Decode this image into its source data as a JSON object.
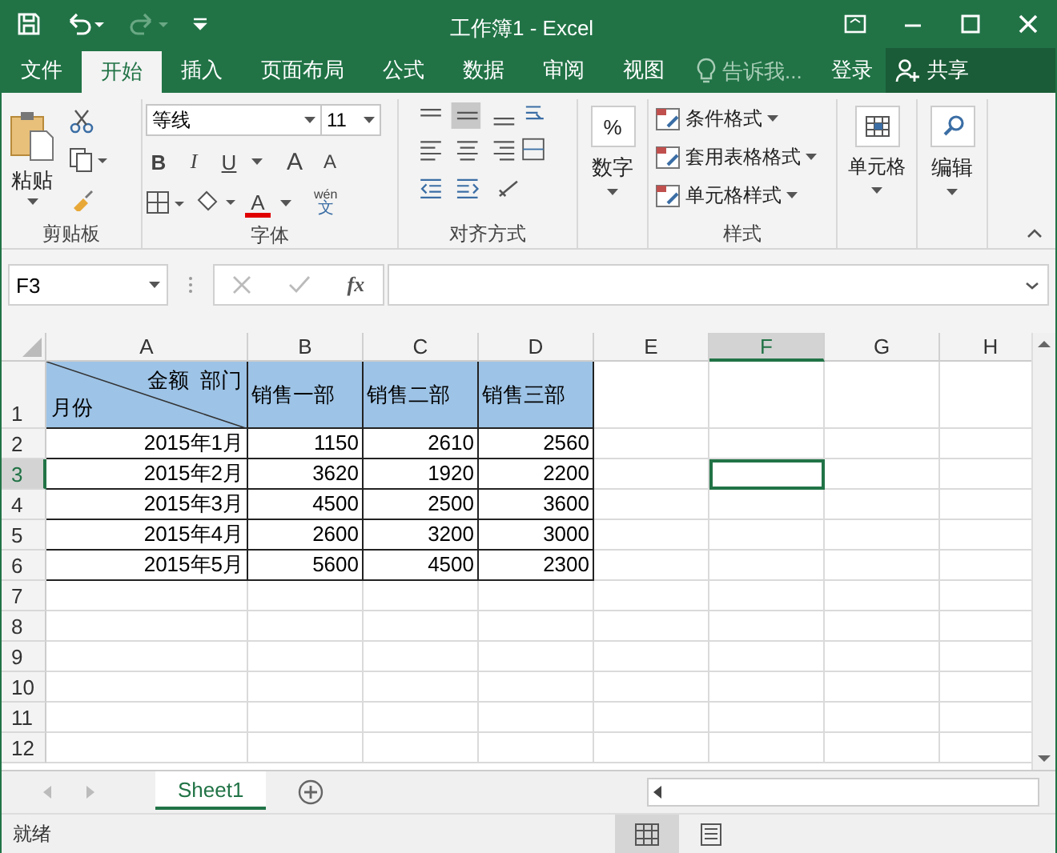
{
  "window": {
    "title": "工作簿1 - Excel"
  },
  "ribbon_tabs": [
    {
      "label": "文件",
      "selected": false
    },
    {
      "label": "开始",
      "selected": true
    },
    {
      "label": "插入",
      "selected": false
    },
    {
      "label": "页面布局",
      "selected": false
    },
    {
      "label": "公式",
      "selected": false
    },
    {
      "label": "数据",
      "selected": false
    },
    {
      "label": "审阅",
      "selected": false
    },
    {
      "label": "视图",
      "selected": false
    }
  ],
  "tell_me": {
    "placeholder": "告诉我..."
  },
  "sign_in": "登录",
  "share": "共享",
  "ribbon": {
    "clipboard": {
      "paste": "粘贴",
      "label": "剪贴板"
    },
    "font": {
      "name": "等线",
      "size": "11",
      "bold": "B",
      "italic": "I",
      "underline": "U",
      "grow": "A",
      "shrink": "A",
      "font_color": "A",
      "phonetic_top": "wén",
      "phonetic_bottom": "文",
      "label": "字体"
    },
    "alignment": {
      "label": "对齐方式"
    },
    "number": {
      "symbol": "%",
      "button": "数字"
    },
    "styles": {
      "items": [
        "条件格式",
        "套用表格格式",
        "单元格样式"
      ],
      "label": "样式"
    },
    "cells": {
      "button": "单元格"
    },
    "editing": {
      "button": "编辑"
    }
  },
  "formula_bar": {
    "name_box": "F3",
    "fx": "fx"
  },
  "columns": [
    {
      "label": "A",
      "selected": false
    },
    {
      "label": "B",
      "selected": false
    },
    {
      "label": "C",
      "selected": false
    },
    {
      "label": "D",
      "selected": false
    },
    {
      "label": "E",
      "selected": false
    },
    {
      "label": "F",
      "selected": true
    },
    {
      "label": "G",
      "selected": false
    },
    {
      "label": "H",
      "selected": false
    }
  ],
  "rows": [
    {
      "label": "1",
      "selected": false,
      "cells": [
        {
          "kind": "diagonal",
          "top": "金额  部门",
          "bottom": "月份"
        },
        {
          "kind": "header",
          "text": "销售一部"
        },
        {
          "kind": "header",
          "text": "销售二部"
        },
        {
          "kind": "header",
          "text": "销售三部"
        }
      ]
    },
    {
      "label": "2",
      "selected": false,
      "cells": [
        {
          "kind": "value",
          "text": "2015年1月"
        },
        {
          "kind": "value",
          "text": "1150"
        },
        {
          "kind": "value",
          "text": "2610"
        },
        {
          "kind": "value",
          "text": "2560"
        }
      ]
    },
    {
      "label": "3",
      "selected": true,
      "cells": [
        {
          "kind": "value",
          "text": "2015年2月"
        },
        {
          "kind": "value",
          "text": "3620"
        },
        {
          "kind": "value",
          "text": "1920"
        },
        {
          "kind": "value",
          "text": "2200"
        }
      ]
    },
    {
      "label": "4",
      "selected": false,
      "cells": [
        {
          "kind": "value",
          "text": "2015年3月"
        },
        {
          "kind": "value",
          "text": "4500"
        },
        {
          "kind": "value",
          "text": "2500"
        },
        {
          "kind": "value",
          "text": "3600"
        }
      ]
    },
    {
      "label": "5",
      "selected": false,
      "cells": [
        {
          "kind": "value",
          "text": "2015年4月"
        },
        {
          "kind": "value",
          "text": "2600"
        },
        {
          "kind": "value",
          "text": "3200"
        },
        {
          "kind": "value",
          "text": "3000"
        }
      ]
    },
    {
      "label": "6",
      "selected": false,
      "cells": [
        {
          "kind": "value",
          "text": "2015年5月"
        },
        {
          "kind": "value",
          "text": "5600"
        },
        {
          "kind": "value",
          "text": "4500"
        },
        {
          "kind": "value",
          "text": "2300"
        }
      ]
    },
    {
      "label": "7",
      "selected": false,
      "cells": []
    },
    {
      "label": "8",
      "selected": false,
      "cells": []
    },
    {
      "label": "9",
      "selected": false,
      "cells": []
    },
    {
      "label": "10",
      "selected": false,
      "cells": []
    },
    {
      "label": "11",
      "selected": false,
      "cells": []
    },
    {
      "label": "12",
      "selected": false,
      "cells": []
    }
  ],
  "sheet_tabs": [
    {
      "label": "Sheet1",
      "selected": true
    }
  ],
  "status_bar": {
    "text": "就绪"
  }
}
